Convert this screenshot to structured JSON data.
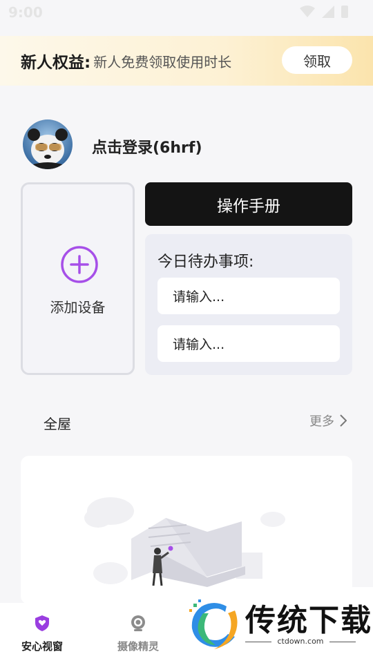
{
  "status_bar": {
    "time": "9:00"
  },
  "promo": {
    "title": "新人权益:",
    "subtitle": "新人免费领取使用时长",
    "claim_label": "领取"
  },
  "user": {
    "login_text": "点击登录(6hrf)"
  },
  "add_device": {
    "label": "添加设备"
  },
  "manual": {
    "label": "操作手册"
  },
  "todo": {
    "title": "今日待办事项:",
    "inputs": [
      {
        "placeholder": "请输入..."
      },
      {
        "placeholder": "请输入..."
      }
    ]
  },
  "section": {
    "title": "全屋",
    "more_label": "更多"
  },
  "tabs": [
    {
      "label": "安心视窗",
      "icon": "shield-heart-icon",
      "active": true
    },
    {
      "label": "摄像精灵",
      "icon": "camera-icon",
      "active": false
    }
  ],
  "watermark": {
    "text": "传统下载",
    "url": "ctdown.com"
  },
  "colors": {
    "accent": "#a64fe8",
    "primary_button": "#141414",
    "promo_start": "#fdf8ea",
    "promo_end": "#fbe4ad"
  }
}
